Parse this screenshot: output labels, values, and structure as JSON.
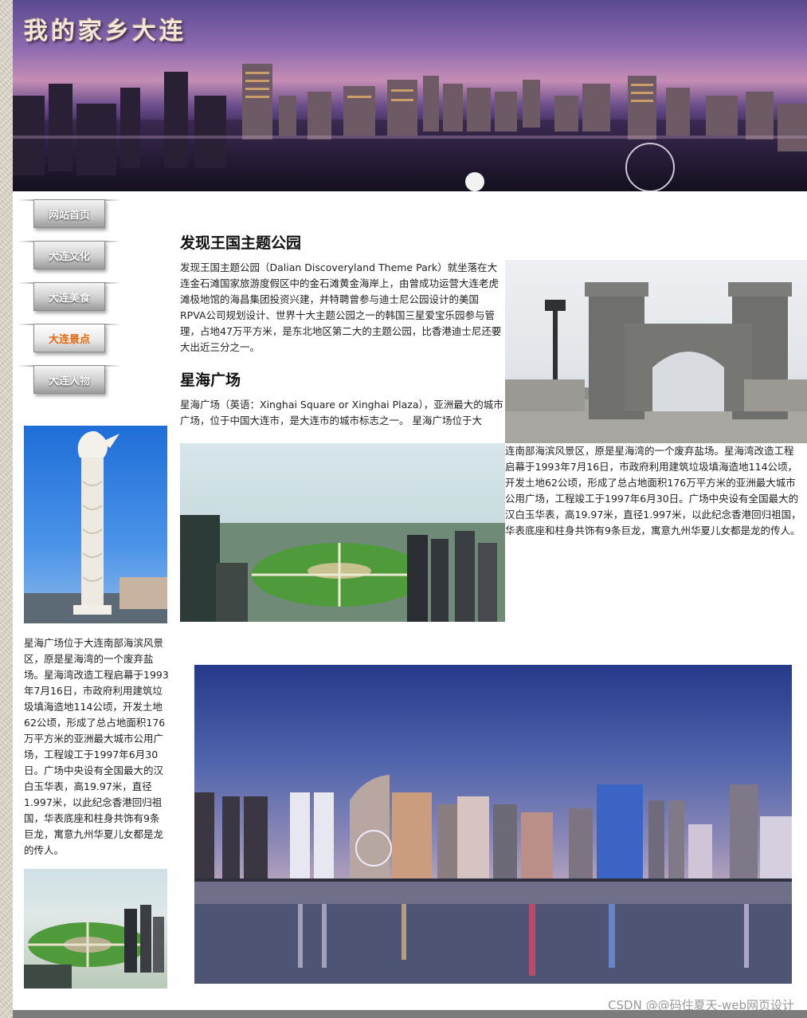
{
  "banner": {
    "title": "我的家乡大连"
  },
  "nav": {
    "items": [
      {
        "label": "网站首页",
        "active": false
      },
      {
        "label": "大连文化",
        "active": false
      },
      {
        "label": "大连美食",
        "active": false
      },
      {
        "label": "大连景点",
        "active": true
      },
      {
        "label": "大连人物",
        "active": false
      }
    ]
  },
  "sidebar": {
    "text": "星海广场位于大连南部海滨风景区，原是星海湾的一个废弃盐场。星海湾改造工程启幕于1993年7月16日，市政府利用建筑垃圾填海造地114公顷，开发土地62公顷，形成了总占地面积176万平方米的亚洲最大城市公用广场，工程竣工于1997年6月30日。广场中央设有全国最大的汉白玉华表，高19.97米，直径1.997米，以此纪念香港回归祖国，华表底座和柱身共饰有9条巨龙，寓意九州华夏儿女都是龙的传人。"
  },
  "sections": {
    "discovery": {
      "title": "发现王国主题公园",
      "text": "发现王国主题公园（Dalian Discoveryland Theme Park）就坐落在大连金石滩国家旅游度假区中的金石滩黄金海岸上，由曾成功运营大连老虎滩极地馆的海昌集团投资兴建，并特聘曾参与迪士尼公园设计的美国RPVA公司规划设计、世界十大主题公园之一的韩国三星爱宝乐园参与管理，占地47万平方米，是东北地区第二大的主题公园，比香港迪士尼还要大出近三分之一。"
    },
    "xinghai": {
      "title": "星海广场",
      "text_a": "星海广场（英语：Xinghai Square or Xinghai Plaza），亚洲最大的城市广场，位于中国大连市，是大连市的城市标志之一。 星海广场位于大",
      "text_b": "连南部海滨风景区，原是星海湾的一个废弃盐场。星海湾改造工程启幕于1993年7月16日，市政府利用建筑垃圾填海造地114公顷，开发土地62公顷，形成了总占地面积176万平方米的亚洲最大城市公用广场，工程竣工于1997年6月30日。广场中央设有全国最大的汉白玉华表，高19.97米，直径1.997米，以此纪念香港回归祖国，华表底座和柱身共饰有9条巨龙，寓意九州华夏儿女都是龙的传人。"
    }
  },
  "footer": {
    "watermark": "CSDN @@码住夏天-web网页设计"
  }
}
